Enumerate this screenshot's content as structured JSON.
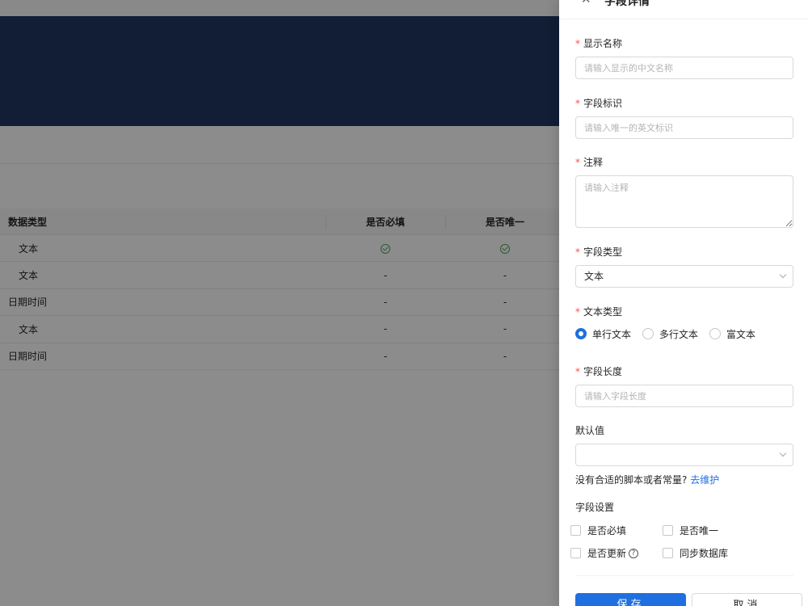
{
  "table": {
    "headers": {
      "type": "数据类型",
      "required": "是否必填",
      "unique": "是否唯一"
    },
    "rows": [
      {
        "type": "文本",
        "required": "check",
        "unique": "check"
      },
      {
        "type": "文本",
        "required": "-",
        "unique": "-"
      },
      {
        "type": "日期时间",
        "required": "-",
        "unique": "-"
      },
      {
        "type": "文本",
        "required": "-",
        "unique": "-"
      },
      {
        "type": "日期时间",
        "required": "-",
        "unique": "-"
      }
    ]
  },
  "drawer": {
    "title": "字段详情",
    "close_icon": "close-icon",
    "display_name": {
      "label": "显示名称",
      "placeholder": "请输入显示的中文名称"
    },
    "field_id": {
      "label": "字段标识",
      "placeholder": "请输入唯一的英文标识"
    },
    "comment": {
      "label": "注释",
      "placeholder": "请输入注释"
    },
    "field_type": {
      "label": "字段类型",
      "value": "文本"
    },
    "text_type": {
      "label": "文本类型",
      "options": [
        "单行文本",
        "多行文本",
        "富文本"
      ],
      "selected": "单行文本"
    },
    "field_length": {
      "label": "字段长度",
      "placeholder": "请输入字段长度"
    },
    "default_value": {
      "label": "默认值",
      "value": ""
    },
    "hint": {
      "text": "没有合适的脚本或者常量?",
      "link": "去维护"
    },
    "settings": {
      "label": "字段设置",
      "options": [
        "是否必填",
        "是否唯一",
        "是否更新",
        "同步数据库"
      ]
    },
    "save_label": "保存",
    "cancel_label": "取消"
  },
  "colors": {
    "primary": "#1f6fe0",
    "banner": "#203863",
    "success": "#52a45a",
    "required": "#ff4d4f"
  }
}
